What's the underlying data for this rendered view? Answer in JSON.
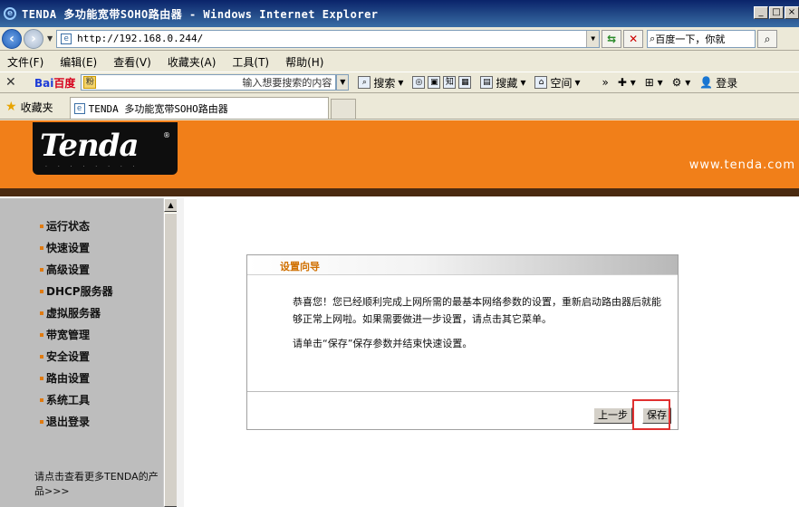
{
  "window": {
    "title": "TENDA 多功能宽带SOHO路由器 - Windows Internet Explorer",
    "icon": "ie-icon"
  },
  "address_bar": {
    "url": "http://192.168.0.244/"
  },
  "search_box": {
    "value": "百度一下，你就"
  },
  "menu": [
    "文件(F)",
    "编辑(E)",
    "查看(V)",
    "收藏夹(A)",
    "工具(T)",
    "帮助(H)"
  ],
  "baidu_toolbar": {
    "logo_prefix": "Bai",
    "logo_suffix": "百度",
    "placeholder": "输入想要搜索的内容",
    "search_label": "搜索",
    "search2_label": "搜藏",
    "space_label": "空间",
    "login_label": "登录"
  },
  "favorites": {
    "label": "收藏夹"
  },
  "tab": {
    "title": "TENDA 多功能宽带SOHO路由器"
  },
  "banner": {
    "logo": "Tenda",
    "url": "www.tenda.com"
  },
  "sidebar": {
    "items": [
      "运行状态",
      "快速设置",
      "高级设置",
      "DHCP服务器",
      "虚拟服务器",
      "带宽管理",
      "安全设置",
      "路由设置",
      "系统工具",
      "退出登录"
    ],
    "note": "请点击查看更多TENDA的产品>>>"
  },
  "wizard": {
    "title": "设置向导",
    "message1": "恭喜您！您已经顺利完成上网所需的最基本网络参数的设置，重新启动路由器后就能够正常上网啦。如果需要做进一步设置，请点击其它菜单。",
    "message2": "请单击“保存”保存参数并结束快速设置。",
    "prev_label": "上一步",
    "save_label": "保存"
  }
}
